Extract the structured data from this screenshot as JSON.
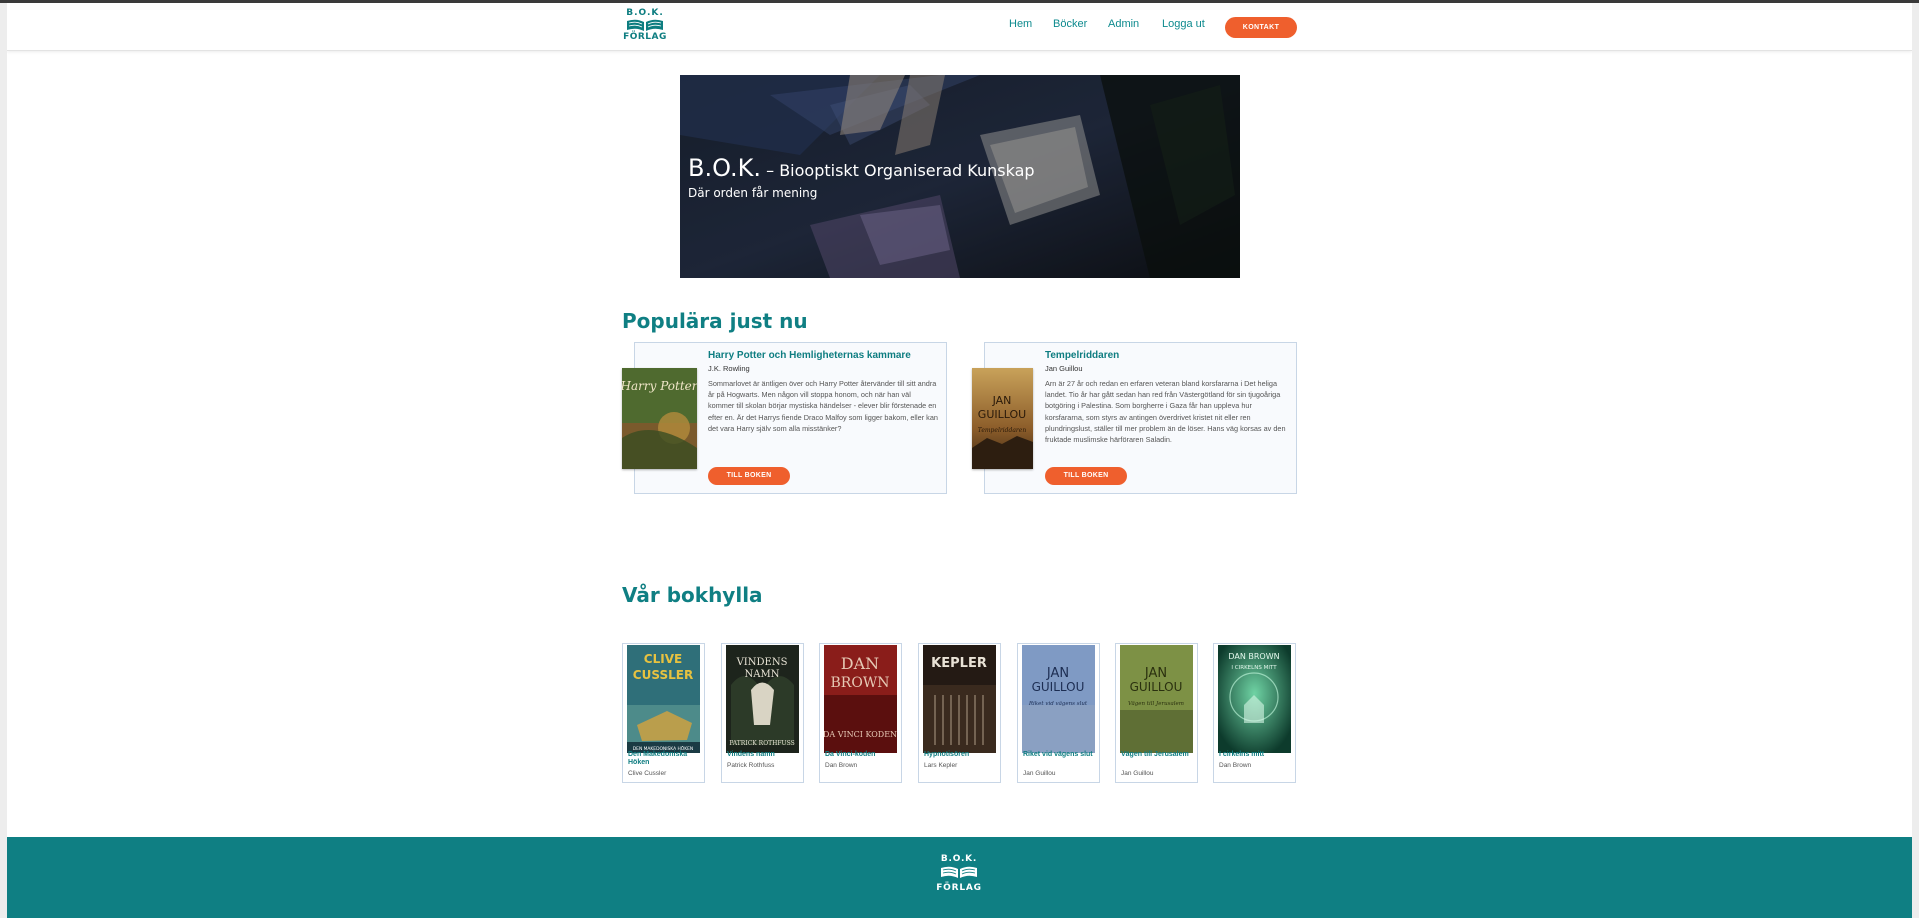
{
  "header": {
    "logo_line1": "B.O.K.",
    "logo_line2": "FÖRLAG",
    "nav": [
      "Hem",
      "Böcker",
      "Admin",
      "Logga ut"
    ],
    "contact_label": "KONTAKT"
  },
  "hero": {
    "title_big": "B.O.K.",
    "title_small": " – Biooptiskt Organiserad Kunskap",
    "subtitle": "Där orden får mening"
  },
  "popular": {
    "heading": "Populära just nu",
    "books": [
      {
        "title": "Harry Potter och Hemligheternas kammare",
        "author": "J.K. Rowling",
        "description": "Sommarlovet är äntligen över och Harry Potter återvänder till sitt andra år på Hogwarts. Men någon vill stoppa honom, och när han väl kommer till skolan börjar mystiska händelser - elever blir förstenade en efter en. Är det Harrys fiende Draco Malfoy som ligger bakom, eller kan det vara Harry själv som alla misstänker?",
        "button": "TILL BOKEN",
        "cover_text": "Harry Potter"
      },
      {
        "title": "Tempelriddaren",
        "author": "Jan Guillou",
        "description": "Arn är 27 år och redan en erfaren veteran bland korsfararna i Det heliga landet. Tio år har gått sedan han red från Västergötland för sin tjugoåriga botgöring i Palestina. Som borgherre i Gaza får han uppleva hur korsfararna, som styrs av antingen överdrivet kristet nit eller ren plundringslust, ställer till mer problem än de löser. Hans väg korsas av den fruktade muslimske härföraren Saladin.",
        "button": "TILL BOKEN",
        "cover_text_1": "JAN",
        "cover_text_2": "GUILLOU",
        "cover_text_3": "Tempelriddaren"
      }
    ]
  },
  "shelf": {
    "heading": "Vår bokhylla",
    "books": [
      {
        "title": "Den Makedoniska Höken",
        "author": "Clive Cussler",
        "cover_top": "CLIVE",
        "cover_mid": "CUSSLER",
        "cover_bottom": "DEN MAKEDONISKA HÖKEN"
      },
      {
        "title": "Vindens namn",
        "author": "Patrick Rothfuss",
        "cover_top": "VINDENS",
        "cover_mid": "NAMN",
        "cover_bottom": "PATRICK ROTHFUSS"
      },
      {
        "title": "Da Vinci-koden",
        "author": "Dan Brown",
        "cover_top": "DAN",
        "cover_mid": "BROWN",
        "cover_bottom": "DA VINCI KODEN"
      },
      {
        "title": "Hypnotisören",
        "author": "Lars Kepler",
        "cover_top": "KEPLER",
        "cover_mid": "",
        "cover_bottom": ""
      },
      {
        "title": "Riket vid vägens slut",
        "author": "Jan Guillou",
        "cover_top": "JAN",
        "cover_mid": "GUILLOU",
        "cover_bottom": "Riket vid vägens slut"
      },
      {
        "title": "Vägen till Jerusalem",
        "author": "Jan Guillou",
        "cover_top": "JAN",
        "cover_mid": "GUILLOU",
        "cover_bottom": "Vägen till Jerusalem"
      },
      {
        "title": "I cirkelns mitt",
        "author": "Dan Brown",
        "cover_top": "DAN BROWN",
        "cover_mid": "I CIRKELNS MITT",
        "cover_bottom": ""
      }
    ]
  },
  "footer": {
    "logo_line1": "B.O.K.",
    "logo_line2": "FÖRLAG"
  }
}
